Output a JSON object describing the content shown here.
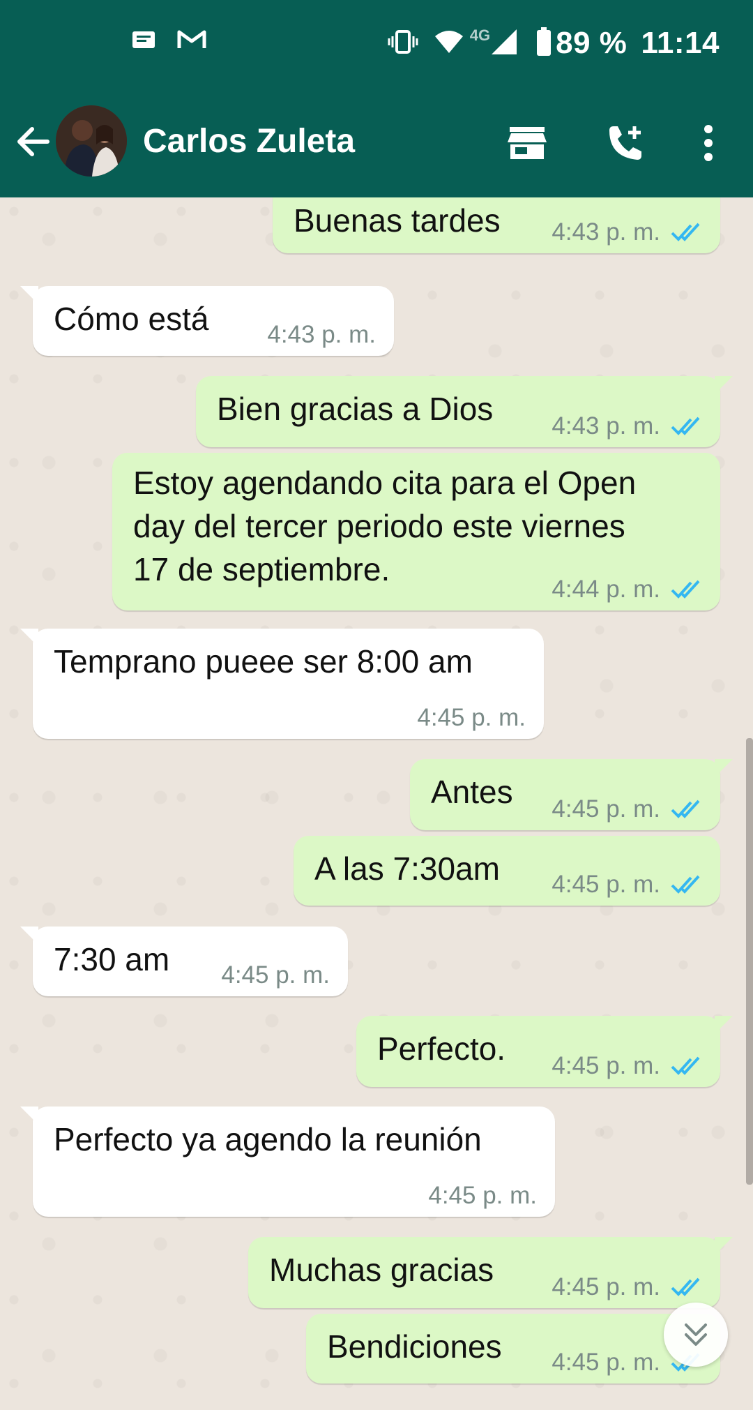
{
  "status_bar": {
    "network": "4G",
    "battery": "89 %",
    "time": "11:14",
    "left_icons": [
      "message-icon",
      "gmail-icon"
    ],
    "right_icons": [
      "vibrate-icon",
      "wifi-icon",
      "signal-icon",
      "battery-icon"
    ]
  },
  "header": {
    "contact_name": "Carlos Zuleta",
    "icons": [
      "back-arrow-icon",
      "avatar",
      "store-icon",
      "add-call-icon",
      "more-vert-icon"
    ]
  },
  "colors": {
    "header": "#075e54",
    "outgoing_bubble": "#dcf8c6",
    "incoming_bubble": "#ffffff",
    "read_tick": "#34b7f1",
    "chat_background": "#ece5dd"
  },
  "messages": [
    {
      "direction": "out",
      "text": "Buenas tardes",
      "time": "4:43 p. m.",
      "status": "read"
    },
    {
      "direction": "in",
      "text": "Cómo está",
      "time": "4:43 p. m."
    },
    {
      "direction": "out",
      "text": "Bien gracias a Dios",
      "time": "4:43 p. m.",
      "status": "read"
    },
    {
      "direction": "out",
      "lines": [
        "Estoy agendando cita para el Open",
        "day del tercer periodo este viernes",
        "17 de septiembre."
      ],
      "time": "4:44 p. m.",
      "status": "read"
    },
    {
      "direction": "in",
      "text": "Temprano pueee ser 8:00 am",
      "time": "4:45 p. m."
    },
    {
      "direction": "out",
      "text": "Antes",
      "time": "4:45 p. m.",
      "status": "read"
    },
    {
      "direction": "out",
      "text": "A las 7:30am",
      "time": "4:45 p. m.",
      "status": "read"
    },
    {
      "direction": "in",
      "text": "7:30 am",
      "time": "4:45 p. m."
    },
    {
      "direction": "out",
      "text": "Perfecto.",
      "time": "4:45 p. m.",
      "status": "read"
    },
    {
      "direction": "in",
      "text": "Perfecto ya agendo la reunión",
      "time": "4:45 p. m."
    },
    {
      "direction": "out",
      "text": "Muchas gracias",
      "time": "4:45 p. m.",
      "status": "read"
    },
    {
      "direction": "out",
      "text": "Bendiciones",
      "time": "4:45 p. m.",
      "status": "read"
    }
  ]
}
